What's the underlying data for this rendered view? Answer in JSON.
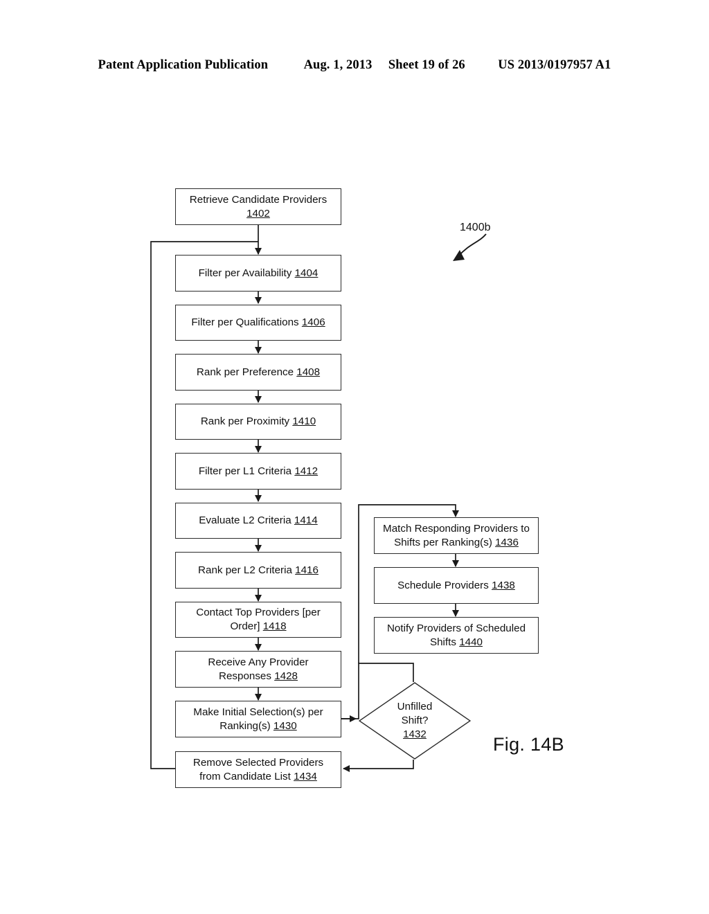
{
  "header": {
    "publication": "Patent Application Publication",
    "date": "Aug. 1, 2013",
    "sheet": "Sheet 19 of 26",
    "number": "US 2013/0197957 A1"
  },
  "figure": {
    "caption": "Fig. 14B",
    "callout_label": "1400b",
    "callout_icon": "curved-arrow-icon"
  },
  "flowchart": {
    "title": "1400b",
    "nodes": [
      {
        "id": "1402",
        "shape": "process",
        "line1": "Retrieve Candidate Providers",
        "line2": "1402",
        "ref": "1402"
      },
      {
        "id": "1404",
        "shape": "process",
        "line1": "Filter per Availability ",
        "line2": "",
        "ref": "1404"
      },
      {
        "id": "1406",
        "shape": "process",
        "line1": "Filter per Qualifications  ",
        "line2": "",
        "ref": "1406"
      },
      {
        "id": "1408",
        "shape": "process",
        "line1": "Rank per Preference ",
        "line2": "",
        "ref": "1408"
      },
      {
        "id": "1410",
        "shape": "process",
        "line1": "Rank per Proximity ",
        "line2": "",
        "ref": "1410"
      },
      {
        "id": "1412",
        "shape": "process",
        "line1": "Filter per L1 Criteria ",
        "line2": "",
        "ref": "1412"
      },
      {
        "id": "1414",
        "shape": "process",
        "line1": "Evaluate L2 Criteria ",
        "line2": "",
        "ref": "1414"
      },
      {
        "id": "1416",
        "shape": "process",
        "line1": "Rank per L2 Criteria ",
        "line2": "",
        "ref": "1416"
      },
      {
        "id": "1418",
        "shape": "process",
        "line1": "Contact Top Providers [per",
        "line2": "Order] ",
        "ref": "1418"
      },
      {
        "id": "1428",
        "shape": "process",
        "line1": "Receive Any Provider",
        "line2": "Responses ",
        "ref": "1428"
      },
      {
        "id": "1430",
        "shape": "process",
        "line1": "Make Initial Selection(s) per",
        "line2": "Ranking(s) ",
        "ref": "1430"
      },
      {
        "id": "1434",
        "shape": "process",
        "line1": "Remove Selected Providers",
        "line2": "from Candidate List ",
        "ref": "1434"
      },
      {
        "id": "1436",
        "shape": "process",
        "line1": "Match Responding Providers to",
        "line2": "Shifts per  Ranking(s) ",
        "ref": "1436"
      },
      {
        "id": "1438",
        "shape": "process",
        "line1": "Schedule Providers ",
        "line2": "",
        "ref": "1438"
      },
      {
        "id": "1440",
        "shape": "process",
        "line1": "Notify Providers of Scheduled",
        "line2": "Shifts ",
        "ref": "1440"
      },
      {
        "id": "1432",
        "shape": "decision",
        "line1": "Unfilled",
        "line2": "Shift?",
        "ref": "1432"
      }
    ]
  },
  "boxes": {
    "b1402": {
      "l1": "Retrieve Candidate Providers",
      "l2": "",
      "ref": "1402"
    },
    "b1404": {
      "l1": "Filter per Availability ",
      "l2": "",
      "ref": "1404"
    },
    "b1406": {
      "l1": "Filter per Qualifications  ",
      "l2": "",
      "ref": "1406"
    },
    "b1408": {
      "l1": "Rank per Preference ",
      "l2": "",
      "ref": "1408"
    },
    "b1410": {
      "l1": "Rank per Proximity ",
      "l2": "",
      "ref": "1410"
    },
    "b1412": {
      "l1": "Filter per L1 Criteria ",
      "l2": "",
      "ref": "1412"
    },
    "b1414": {
      "l1": "Evaluate L2 Criteria ",
      "l2": "",
      "ref": "1414"
    },
    "b1416": {
      "l1": "Rank per L2 Criteria ",
      "l2": "",
      "ref": "1416"
    },
    "b1418": {
      "l1": "Contact Top Providers [per",
      "l2": "Order] ",
      "ref": "1418"
    },
    "b1428": {
      "l1": "Receive Any Provider",
      "l2": "Responses ",
      "ref": "1428"
    },
    "b1430": {
      "l1": "Make Initial Selection(s) per",
      "l2": "Ranking(s) ",
      "ref": "1430"
    },
    "b1434": {
      "l1": "Remove Selected Providers",
      "l2": "from Candidate List ",
      "ref": "1434"
    },
    "b1436": {
      "l1": "Match Responding Providers to",
      "l2": "Shifts per  Ranking(s) ",
      "ref": "1436"
    },
    "b1438": {
      "l1": "Schedule Providers ",
      "l2": "",
      "ref": "1438"
    },
    "b1440": {
      "l1": "Notify Providers of Scheduled",
      "l2": "Shifts ",
      "ref": "1440"
    },
    "b1432": {
      "l1": "Unfilled",
      "l2": "Shift?",
      "ref": "1432"
    }
  },
  "colors": {
    "ink": "#000000",
    "box_stroke": "#2b2b2b",
    "wire": "#1a1a1a",
    "page": "#ffffff"
  }
}
